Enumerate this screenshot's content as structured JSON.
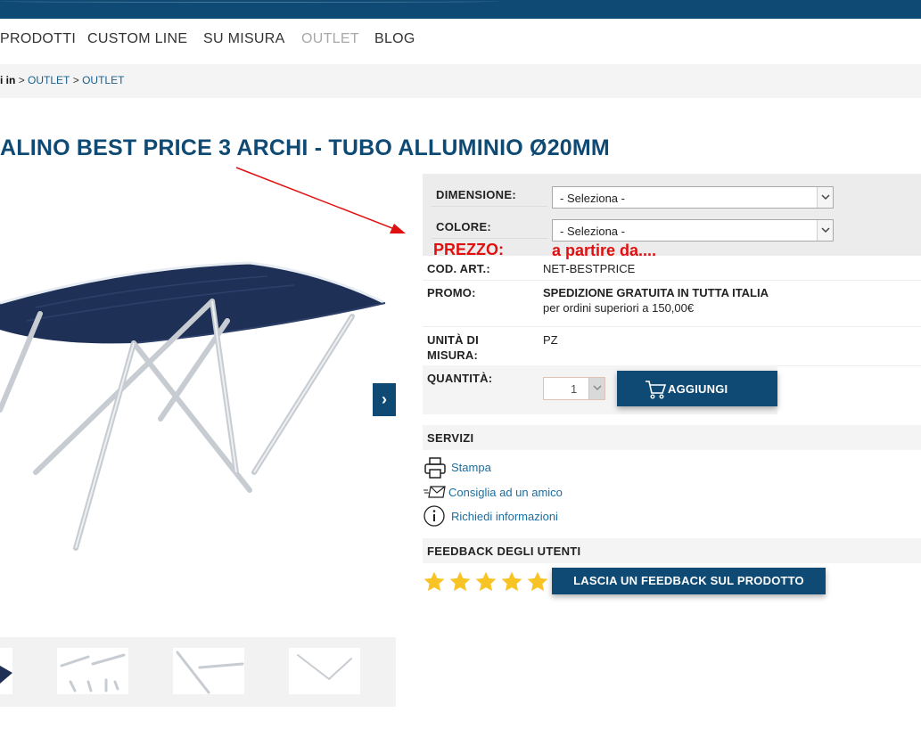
{
  "nav": {
    "items": [
      {
        "label": "PRODOTTI"
      },
      {
        "label": "CUSTOM LINE"
      },
      {
        "label": "SU MISURA"
      },
      {
        "label": "OUTLET"
      },
      {
        "label": "BLOG"
      }
    ]
  },
  "breadcrumb": {
    "lead": "i in",
    "sep": ">",
    "links": [
      "OUTLET",
      "OUTLET"
    ]
  },
  "product": {
    "title": "ALINO BEST PRICE 3 ARCHI - TUBO ALLUMINIO Ø20MM"
  },
  "options": {
    "dimensione_label": "DIMENSIONE:",
    "dimensione_value": "- Seleziona -",
    "colore_label": "COLORE:",
    "colore_value": "- Seleziona -",
    "prezzo_label": "PREZZO:",
    "prezzo_value": "a partire da...."
  },
  "details": {
    "cod_label": "COD. ART.:",
    "cod_value": "NET-BESTPRICE",
    "promo_label": "PROMO:",
    "promo_title": "SPEDIZIONE GRATUITA IN TUTTA ITALIA",
    "promo_sub": "per ordini superiori a 150,00€",
    "unita_label_1": "UNITÀ DI",
    "unita_label_2": "MISURA:",
    "unita_value": "PZ",
    "qty_label": "QUANTITÀ:",
    "qty_value": "1",
    "add_button": "AGGIUNGI"
  },
  "services": {
    "heading": "SERVIZI",
    "items": [
      {
        "label": "Stampa",
        "icon": "printer-icon"
      },
      {
        "label": "Consiglia ad un amico",
        "icon": "mail-icon"
      },
      {
        "label": "Richiedi informazioni",
        "icon": "info-icon"
      }
    ]
  },
  "feedback": {
    "heading": "FEEDBACK DEGLI UTENTI",
    "stars": 5,
    "button": "LASCIA UN FEEDBACK SUL PRODOTTO"
  },
  "colors": {
    "brand": "#0e4a73",
    "link": "#1b6ea0",
    "annotation_red": "#e01010",
    "star": "#f7c325"
  }
}
